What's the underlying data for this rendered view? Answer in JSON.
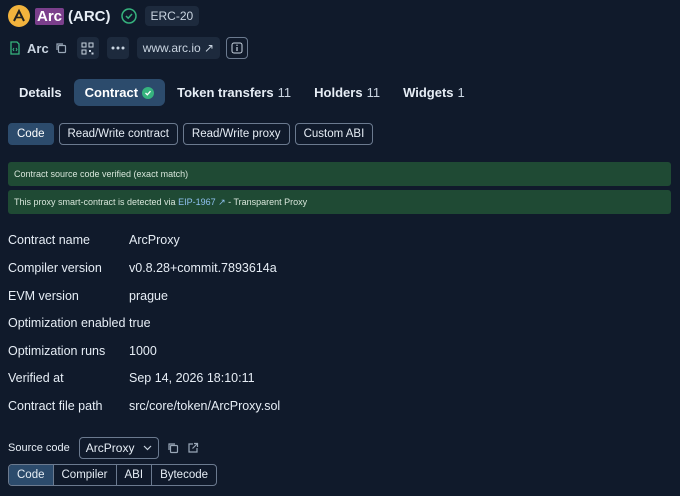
{
  "header": {
    "token_name": "Arc",
    "token_symbol": "(ARC)",
    "standard_badge": "ERC-20",
    "address_label": "Arc",
    "website": "www.arc.io",
    "icons": {
      "logo": "arc-logo",
      "verified": "shield-check-icon",
      "contract": "file-code-icon",
      "copy": "copy-icon",
      "qr": "qr-code-icon",
      "more": "more-dots-icon",
      "external": "arrow-up-right-icon",
      "info": "info-icon"
    }
  },
  "tabs": [
    {
      "label": "Details",
      "count": ""
    },
    {
      "label": "Contract",
      "count": ""
    },
    {
      "label": "Token transfers",
      "count": "11"
    },
    {
      "label": "Holders",
      "count": "11"
    },
    {
      "label": "Widgets",
      "count": "1"
    }
  ],
  "subtabs": [
    "Code",
    "Read/Write contract",
    "Read/Write proxy",
    "Custom ABI"
  ],
  "notices": {
    "verified": "Contract source code verified (exact match)",
    "proxy_prefix": "This proxy smart-contract is detected via ",
    "proxy_link": "EIP-1967",
    "proxy_suffix": " - Transparent Proxy"
  },
  "details": [
    {
      "key": "Contract name",
      "value": "ArcProxy"
    },
    {
      "key": "Compiler version",
      "value": "v0.8.28+commit.7893614a"
    },
    {
      "key": "EVM version",
      "value": "prague"
    },
    {
      "key": "Optimization enabled",
      "value": "true"
    },
    {
      "key": "Optimization runs",
      "value": "1000"
    },
    {
      "key": "Verified at",
      "value": "Sep 14, 2026 18:10:11"
    },
    {
      "key": "Contract file path",
      "value": "src/core/token/ArcProxy.sol"
    }
  ],
  "source": {
    "label": "Source code",
    "selected": "ArcProxy"
  },
  "bottom_tabs": [
    "Code",
    "Compiler",
    "ABI",
    "Bytecode"
  ],
  "colors": {
    "background": "#101a2b",
    "active_tab": "#2c4b6c",
    "notice": "#1f4a34",
    "logo": "#f2b33d"
  }
}
